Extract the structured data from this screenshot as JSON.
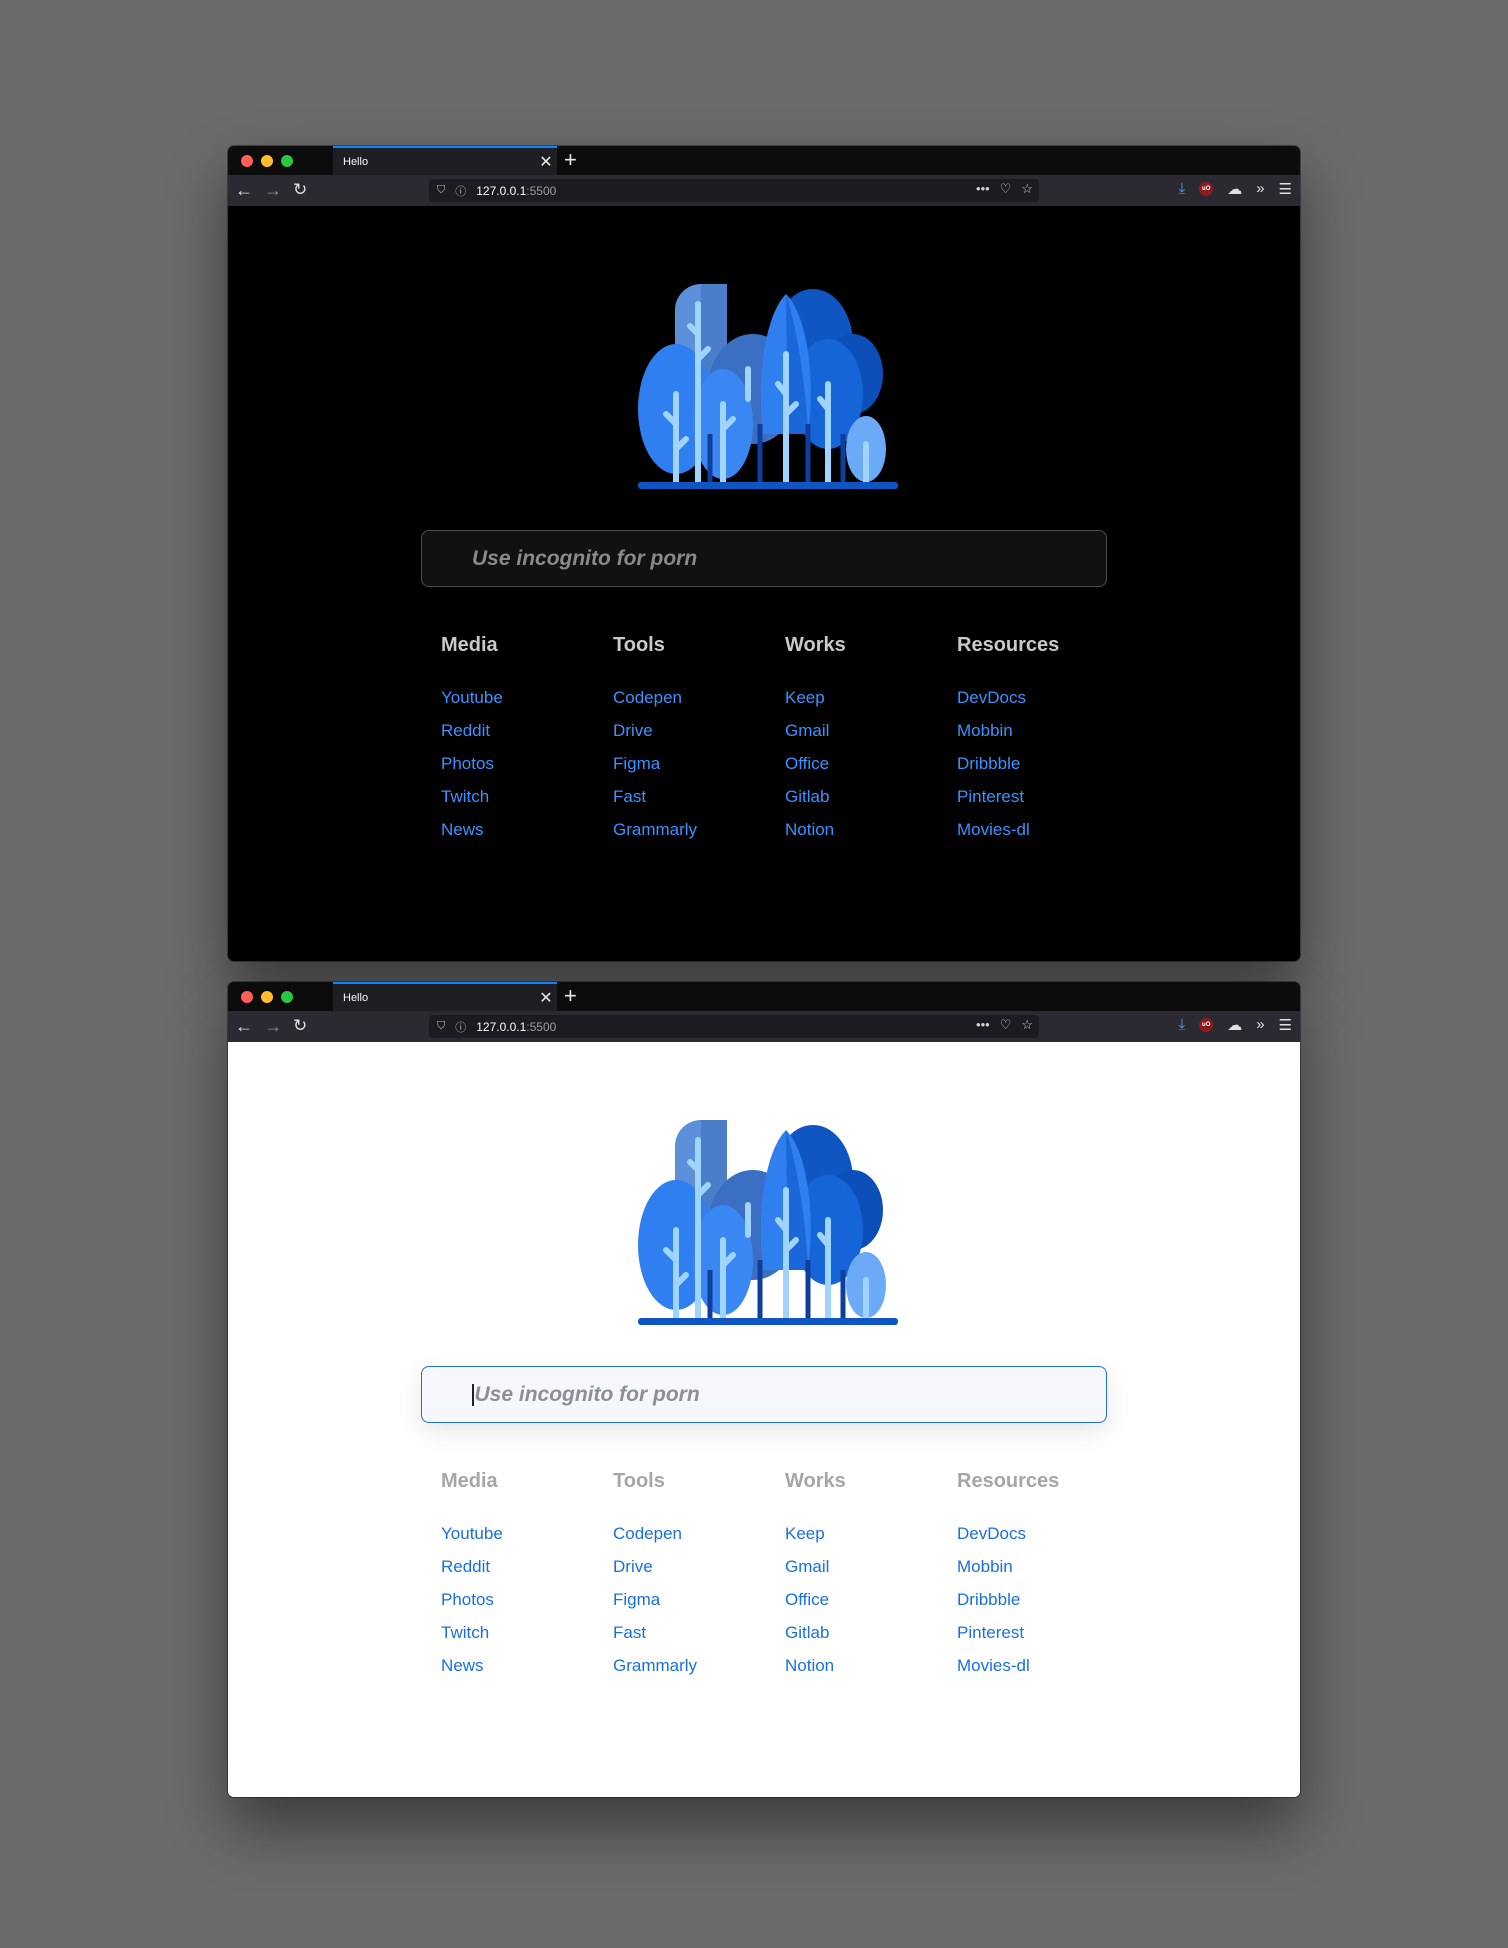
{
  "windows": [
    {
      "theme": "dark",
      "tab_title": "Hello",
      "url_host": "127.0.0.1",
      "url_port": ":5500",
      "search_placeholder": "Use incognito for porn",
      "columns": [
        {
          "title": "Media",
          "links": [
            "Youtube",
            "Reddit",
            "Photos",
            "Twitch",
            "News"
          ]
        },
        {
          "title": "Tools",
          "links": [
            "Codepen",
            "Drive",
            "Figma",
            "Fast",
            "Grammarly"
          ]
        },
        {
          "title": "Works",
          "links": [
            "Keep",
            "Gmail",
            "Office",
            "Gitlab",
            "Notion"
          ]
        },
        {
          "title": "Resources",
          "links": [
            "DevDocs",
            "Mobbin",
            "Dribbble",
            "Pinterest",
            "Movies-dl"
          ]
        }
      ]
    },
    {
      "theme": "light",
      "tab_title": "Hello",
      "url_host": "127.0.0.1",
      "url_port": ":5500",
      "search_placeholder": "Use incognito for porn",
      "columns": [
        {
          "title": "Media",
          "links": [
            "Youtube",
            "Reddit",
            "Photos",
            "Twitch",
            "News"
          ]
        },
        {
          "title": "Tools",
          "links": [
            "Codepen",
            "Drive",
            "Figma",
            "Fast",
            "Grammarly"
          ]
        },
        {
          "title": "Works",
          "links": [
            "Keep",
            "Gmail",
            "Office",
            "Gitlab",
            "Notion"
          ]
        },
        {
          "title": "Resources",
          "links": [
            "DevDocs",
            "Mobbin",
            "Dribbble",
            "Pinterest",
            "Movies-dl"
          ]
        }
      ]
    }
  ],
  "icons": {
    "close": "✕",
    "new_tab": "+",
    "back": "←",
    "forward": "→",
    "reload": "↻",
    "shield": "⛉",
    "info": "ⓘ",
    "more": "•••",
    "pocket": "♡",
    "star": "☆",
    "download": "⤓",
    "ublock": "uO",
    "cloud": "☁",
    "overflow": "»",
    "menu": "☰"
  },
  "colors": {
    "accent_blue": "#0a84ff",
    "link_dark": "#3b92ff",
    "link_light": "#1a6fe0",
    "logo_blue": "#2f7ff0",
    "logo_light": "#9fd4ff"
  }
}
